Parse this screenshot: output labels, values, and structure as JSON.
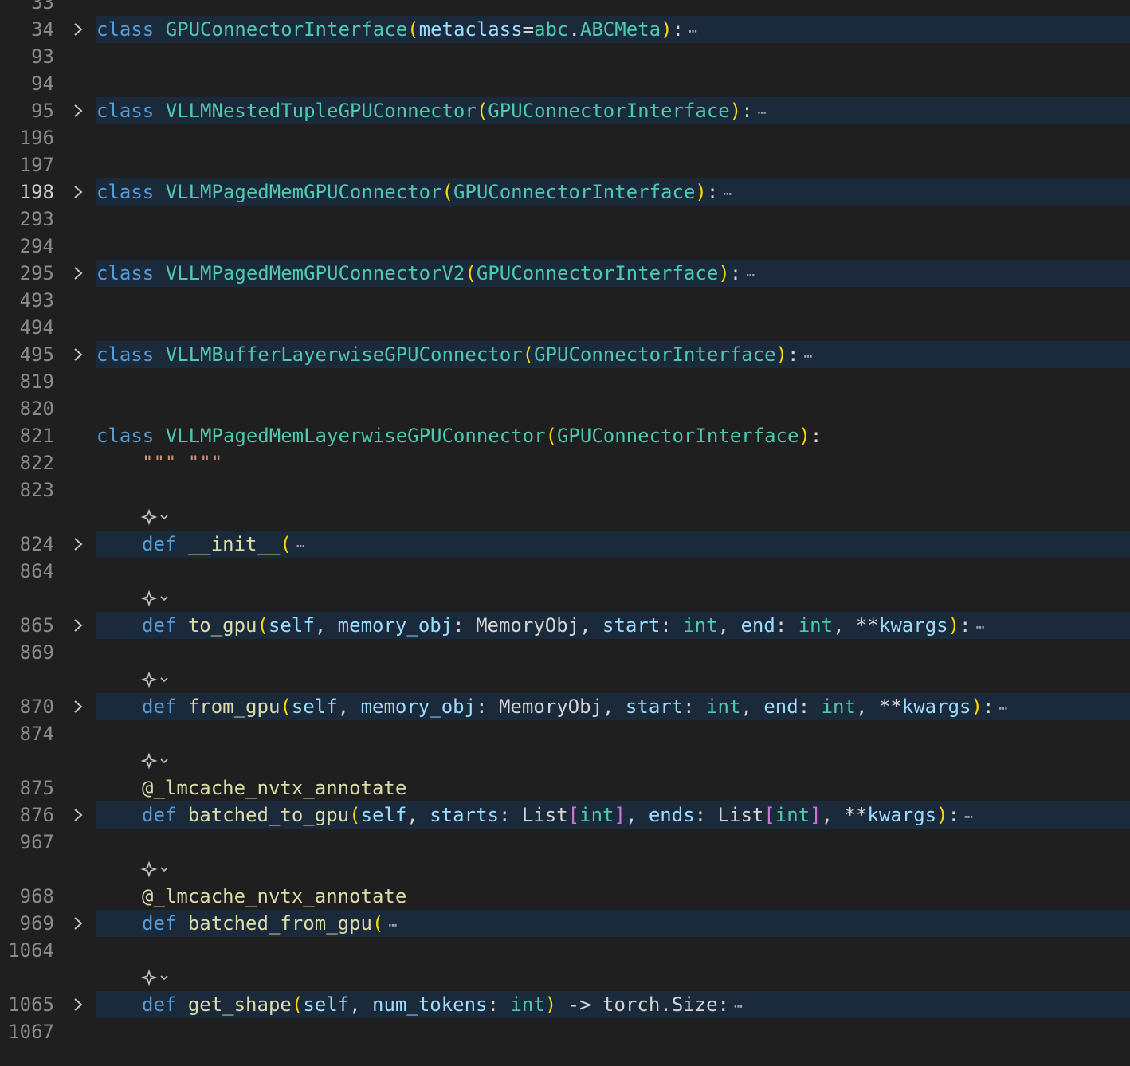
{
  "editor": {
    "colors": {
      "background": "#1f1f1f",
      "folded_highlight": "#1b2a3b",
      "line_number": "#8b8b8b",
      "line_number_current": "#cccccc",
      "keyword": "#569cd6",
      "class_name": "#4ec9b0",
      "function": "#dcdcaa",
      "parameter": "#9cdcfe",
      "bracket_paren": "#ffd700",
      "bracket_square": "#da70d6",
      "string": "#ce9178"
    },
    "fold_icon": "chevron-right-icon",
    "codelens_icon": "copilot-sparkle-icon",
    "lines": [
      {
        "num": "33",
        "tokens": []
      },
      {
        "num": "34",
        "folded": true,
        "tokens": [
          {
            "t": "class",
            "c": "kw"
          },
          {
            "t": " "
          },
          {
            "t": "GPUConnectorInterface",
            "c": "cls"
          },
          {
            "t": "(",
            "c": "paren"
          },
          {
            "t": "metaclass",
            "c": "param"
          },
          {
            "t": "="
          },
          {
            "t": "abc",
            "c": "cls"
          },
          {
            "t": "."
          },
          {
            "t": "ABCMeta",
            "c": "cls"
          },
          {
            "t": ")",
            "c": "paren"
          },
          {
            "t": ":"
          }
        ]
      },
      {
        "num": "93",
        "tokens": []
      },
      {
        "num": "94",
        "tokens": []
      },
      {
        "num": "95",
        "folded": true,
        "tokens": [
          {
            "t": "class",
            "c": "kw"
          },
          {
            "t": " "
          },
          {
            "t": "VLLMNestedTupleGPUConnector",
            "c": "cls"
          },
          {
            "t": "(",
            "c": "paren"
          },
          {
            "t": "GPUConnectorInterface",
            "c": "cls"
          },
          {
            "t": ")",
            "c": "paren"
          },
          {
            "t": ":"
          }
        ]
      },
      {
        "num": "196",
        "tokens": []
      },
      {
        "num": "197",
        "tokens": []
      },
      {
        "num": "198",
        "folded": true,
        "current": true,
        "tokens": [
          {
            "t": "class",
            "c": "kw"
          },
          {
            "t": " "
          },
          {
            "t": "VLLMPagedMemGPUConnector",
            "c": "cls"
          },
          {
            "t": "(",
            "c": "paren"
          },
          {
            "t": "GPUConnectorInterface",
            "c": "cls"
          },
          {
            "t": ")",
            "c": "paren"
          },
          {
            "t": ":"
          }
        ]
      },
      {
        "num": "293",
        "tokens": []
      },
      {
        "num": "294",
        "tokens": []
      },
      {
        "num": "295",
        "folded": true,
        "tokens": [
          {
            "t": "class",
            "c": "kw"
          },
          {
            "t": " "
          },
          {
            "t": "VLLMPagedMemGPUConnectorV2",
            "c": "cls"
          },
          {
            "t": "(",
            "c": "paren"
          },
          {
            "t": "GPUConnectorInterface",
            "c": "cls"
          },
          {
            "t": ")",
            "c": "paren"
          },
          {
            "t": ":"
          }
        ]
      },
      {
        "num": "493",
        "tokens": []
      },
      {
        "num": "494",
        "tokens": []
      },
      {
        "num": "495",
        "folded": true,
        "tokens": [
          {
            "t": "class",
            "c": "kw"
          },
          {
            "t": " "
          },
          {
            "t": "VLLMBufferLayerwiseGPUConnector",
            "c": "cls"
          },
          {
            "t": "(",
            "c": "paren"
          },
          {
            "t": "GPUConnectorInterface",
            "c": "cls"
          },
          {
            "t": ")",
            "c": "paren"
          },
          {
            "t": ":"
          }
        ]
      },
      {
        "num": "819",
        "tokens": []
      },
      {
        "num": "820",
        "tokens": []
      },
      {
        "num": "821",
        "tokens": [
          {
            "t": "class",
            "c": "kw"
          },
          {
            "t": " "
          },
          {
            "t": "VLLMPagedMemLayerwiseGPUConnector",
            "c": "cls"
          },
          {
            "t": "(",
            "c": "paren"
          },
          {
            "t": "GPUConnectorInterface",
            "c": "cls"
          },
          {
            "t": ")",
            "c": "paren"
          },
          {
            "t": ":"
          }
        ]
      },
      {
        "num": "822",
        "indent": 1,
        "tokens": [
          {
            "t": "\"\"\" \"\"\"",
            "c": "str"
          }
        ]
      },
      {
        "num": "823",
        "tokens": []
      },
      {
        "num": "",
        "lens": true
      },
      {
        "num": "824",
        "folded": true,
        "indent": 1,
        "tokens": [
          {
            "t": "def",
            "c": "kw"
          },
          {
            "t": " "
          },
          {
            "t": "__init__",
            "c": "fn"
          },
          {
            "t": "(",
            "c": "paren"
          }
        ]
      },
      {
        "num": "864",
        "tokens": []
      },
      {
        "num": "",
        "lens": true
      },
      {
        "num": "865",
        "folded": true,
        "indent": 1,
        "tokens": [
          {
            "t": "def",
            "c": "kw"
          },
          {
            "t": " "
          },
          {
            "t": "to_gpu",
            "c": "fn"
          },
          {
            "t": "(",
            "c": "paren"
          },
          {
            "t": "self",
            "c": "param"
          },
          {
            "t": ", "
          },
          {
            "t": "memory_obj",
            "c": "param"
          },
          {
            "t": ": "
          },
          {
            "t": "MemoryObj"
          },
          {
            "t": ", "
          },
          {
            "t": "start",
            "c": "param"
          },
          {
            "t": ": "
          },
          {
            "t": "int",
            "c": "cls"
          },
          {
            "t": ", "
          },
          {
            "t": "end",
            "c": "param"
          },
          {
            "t": ": "
          },
          {
            "t": "int",
            "c": "cls"
          },
          {
            "t": ", "
          },
          {
            "t": "**"
          },
          {
            "t": "kwargs",
            "c": "param"
          },
          {
            "t": ")",
            "c": "paren"
          },
          {
            "t": ":"
          }
        ]
      },
      {
        "num": "869",
        "tokens": []
      },
      {
        "num": "",
        "lens": true
      },
      {
        "num": "870",
        "folded": true,
        "indent": 1,
        "tokens": [
          {
            "t": "def",
            "c": "kw"
          },
          {
            "t": " "
          },
          {
            "t": "from_gpu",
            "c": "fn"
          },
          {
            "t": "(",
            "c": "paren"
          },
          {
            "t": "self",
            "c": "param"
          },
          {
            "t": ", "
          },
          {
            "t": "memory_obj",
            "c": "param"
          },
          {
            "t": ": "
          },
          {
            "t": "MemoryObj"
          },
          {
            "t": ", "
          },
          {
            "t": "start",
            "c": "param"
          },
          {
            "t": ": "
          },
          {
            "t": "int",
            "c": "cls"
          },
          {
            "t": ", "
          },
          {
            "t": "end",
            "c": "param"
          },
          {
            "t": ": "
          },
          {
            "t": "int",
            "c": "cls"
          },
          {
            "t": ", "
          },
          {
            "t": "**"
          },
          {
            "t": "kwargs",
            "c": "param"
          },
          {
            "t": ")",
            "c": "paren"
          },
          {
            "t": ":"
          }
        ]
      },
      {
        "num": "874",
        "tokens": []
      },
      {
        "num": "",
        "lens": true
      },
      {
        "num": "875",
        "indent": 1,
        "tokens": [
          {
            "t": "@_lmcache_nvtx_annotate",
            "c": "dec"
          }
        ]
      },
      {
        "num": "876",
        "folded": true,
        "indent": 1,
        "tokens": [
          {
            "t": "def",
            "c": "kw"
          },
          {
            "t": " "
          },
          {
            "t": "batched_to_gpu",
            "c": "fn"
          },
          {
            "t": "(",
            "c": "paren"
          },
          {
            "t": "self",
            "c": "param"
          },
          {
            "t": ", "
          },
          {
            "t": "starts",
            "c": "param"
          },
          {
            "t": ": "
          },
          {
            "t": "List"
          },
          {
            "t": "[",
            "c": "bracket"
          },
          {
            "t": "int",
            "c": "cls"
          },
          {
            "t": "]",
            "c": "bracket"
          },
          {
            "t": ", "
          },
          {
            "t": "ends",
            "c": "param"
          },
          {
            "t": ": "
          },
          {
            "t": "List"
          },
          {
            "t": "[",
            "c": "bracket"
          },
          {
            "t": "int",
            "c": "cls"
          },
          {
            "t": "]",
            "c": "bracket"
          },
          {
            "t": ", "
          },
          {
            "t": "**"
          },
          {
            "t": "kwargs",
            "c": "param"
          },
          {
            "t": ")",
            "c": "paren"
          },
          {
            "t": ":"
          }
        ]
      },
      {
        "num": "967",
        "tokens": []
      },
      {
        "num": "",
        "lens": true
      },
      {
        "num": "968",
        "indent": 1,
        "tokens": [
          {
            "t": "@_lmcache_nvtx_annotate",
            "c": "dec"
          }
        ]
      },
      {
        "num": "969",
        "folded": true,
        "indent": 1,
        "tokens": [
          {
            "t": "def",
            "c": "kw"
          },
          {
            "t": " "
          },
          {
            "t": "batched_from_gpu",
            "c": "fn"
          },
          {
            "t": "(",
            "c": "paren"
          }
        ]
      },
      {
        "num": "1064",
        "tokens": []
      },
      {
        "num": "",
        "lens": true
      },
      {
        "num": "1065",
        "folded": true,
        "indent": 1,
        "tokens": [
          {
            "t": "def",
            "c": "kw"
          },
          {
            "t": " "
          },
          {
            "t": "get_shape",
            "c": "fn"
          },
          {
            "t": "(",
            "c": "paren"
          },
          {
            "t": "self",
            "c": "param"
          },
          {
            "t": ", "
          },
          {
            "t": "num_tokens",
            "c": "param"
          },
          {
            "t": ": "
          },
          {
            "t": "int",
            "c": "cls"
          },
          {
            "t": ")",
            "c": "paren"
          },
          {
            "t": " -> "
          },
          {
            "t": "torch"
          },
          {
            "t": "."
          },
          {
            "t": "Size"
          },
          {
            "t": ":"
          }
        ]
      },
      {
        "num": "1067",
        "tokens": []
      }
    ]
  }
}
